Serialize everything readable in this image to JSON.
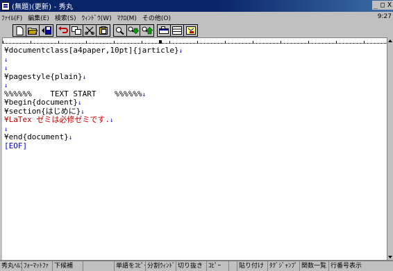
{
  "window": {
    "title": "(無題)(更新) - 秀丸",
    "minimize": "_",
    "maximize": "□",
    "close": "X"
  },
  "menubar": {
    "items": [
      "ﾌｧｲﾙ(F)",
      "編集(E)",
      "検索(S)",
      "ｳｨﾝﾄﾞｳ(W)",
      "ﾏｸﾛ(M)",
      "その他(O)"
    ],
    "clock": "9:27"
  },
  "editor": {
    "lines": [
      {
        "text": "¥documentclass[a4paper,10pt]{jarticle}",
        "mark": "↓",
        "color": "#000000"
      },
      {
        "text": "",
        "mark": "↓",
        "color": "#000000"
      },
      {
        "text": "",
        "mark": "↓",
        "color": "#000000"
      },
      {
        "text": "¥pagestyle{plain}",
        "mark": "↓",
        "color": "#000000"
      },
      {
        "text": "",
        "mark": "↓",
        "color": "#000000"
      },
      {
        "text": "%%%%%%    TEXT START    %%%%%%",
        "mark": "↓",
        "color": "#000000"
      },
      {
        "text": "¥begin{document}",
        "mark": "↓",
        "color": "#000000"
      },
      {
        "text": "¥section{はじめに}",
        "mark": "↓",
        "color": "#000000"
      },
      {
        "text": "¥LaTex ゼミは必修ゼミです.",
        "mark": "↓",
        "color": "#c00000"
      },
      {
        "text": "",
        "mark": "↓",
        "color": "#000000"
      },
      {
        "text": "¥end{document}",
        "mark": "↓",
        "color": "#000000"
      },
      {
        "text": "[EOF]",
        "mark": "",
        "color": "#0000c0"
      }
    ]
  },
  "function_keys": [
    "秀丸ﾍﾙﾌﾟ",
    "ﾌｫｰﾏｯﾄﾌｧ",
    "下候補",
    "",
    "単語をｺﾋﾟｰ",
    "分割ｳｨﾝﾄﾞ",
    "切り抜き",
    "ｺﾋﾟｰ",
    "",
    "貼り付け",
    "ﾀｸﾞｼﾞｬﾝﾌﾟ",
    "関数一覧",
    "行番号表示"
  ],
  "colors": {
    "titlebar": "#0a246a",
    "chrome": "#c0c0c0",
    "return_mark": "#0000c0",
    "highlight_text": "#c00000"
  }
}
